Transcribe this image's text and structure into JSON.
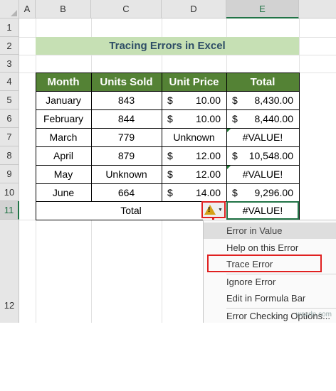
{
  "columns": [
    "A",
    "B",
    "C",
    "D",
    "E"
  ],
  "rows": [
    "1",
    "2",
    "3",
    "4",
    "5",
    "6",
    "7",
    "8",
    "9",
    "10",
    "11",
    "12"
  ],
  "title": "Tracing Errors in Excel",
  "table": {
    "headers": [
      "Month",
      "Units Sold",
      "Unit Price",
      "Total"
    ],
    "currency": "$",
    "rows": [
      {
        "month": "January",
        "units": "843",
        "price": "10.00",
        "total": "8,430.00"
      },
      {
        "month": "February",
        "units": "844",
        "price": "10.00",
        "total": "8,440.00"
      },
      {
        "month": "March",
        "units": "779",
        "price": "Unknown",
        "total": "#VALUE!"
      },
      {
        "month": "April",
        "units": "879",
        "price": "12.00",
        "total": "10,548.00"
      },
      {
        "month": "May",
        "units": "Unknown",
        "price": "12.00",
        "total": "#VALUE!"
      },
      {
        "month": "June",
        "units": "664",
        "price": "14.00",
        "total": "9,296.00"
      }
    ],
    "total_label": "Total",
    "total_value": "#VALUE!"
  },
  "error_menu": {
    "items": [
      "Error in Value",
      "Help on this Error",
      "Trace Error",
      "Ignore Error",
      "Edit in Formula Bar",
      "Error Checking Options..."
    ]
  },
  "warning_glyph": "!",
  "dropdown_glyph": "▼",
  "watermark": "wsxdn.com",
  "colors": {
    "header_green": "#548235",
    "title_bg": "#c6e0b4",
    "title_text": "#2e4d66",
    "highlight_red": "#e02020",
    "selection_green": "#217346"
  }
}
